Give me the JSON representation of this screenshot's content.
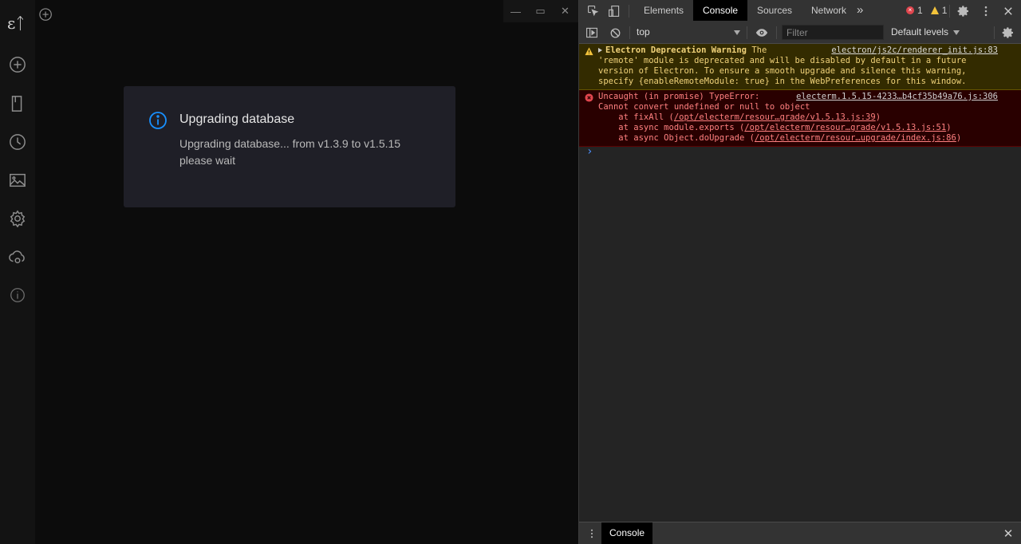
{
  "app": {
    "logo_text": "ɛᛏ",
    "sidebar": [
      {
        "icon": "add-circle-icon"
      },
      {
        "icon": "bookmark-icon"
      },
      {
        "icon": "history-icon"
      },
      {
        "icon": "image-icon"
      },
      {
        "icon": "settings-gear-icon"
      },
      {
        "icon": "cloud-sync-icon"
      },
      {
        "icon": "info-circle-icon"
      }
    ],
    "window_controls": {
      "minimize": "—",
      "maximize": "▭",
      "close": "✕"
    }
  },
  "modal": {
    "title": "Upgrading database",
    "line1": "Upgrading database... from v1.3.9 to v1.5.15",
    "line2": "please wait",
    "accent": "#1890ff"
  },
  "devtools": {
    "tabs": [
      "Elements",
      "Console",
      "Sources",
      "Network"
    ],
    "active_tab": "Console",
    "more_tabs": "»",
    "error_count": "1",
    "warning_count": "1",
    "context": "top",
    "filter_placeholder": "Filter",
    "levels": "Default levels",
    "messages": {
      "warning": {
        "title": "Electron Deprecation Warning",
        "text_lead": " The",
        "source": "electron/js2c/renderer_init.js:83",
        "lines": [
          "'remote' module is deprecated and will be disabled by default in a future",
          "version of Electron. To ensure a smooth upgrade and silence this warning,",
          "specify {enableRemoteModule: true} in the WebPreferences for this window."
        ]
      },
      "error": {
        "head": "Uncaught (in promise) TypeError:",
        "source": "electerm.1.5.15-4233…b4cf35b49a76.js:306",
        "line2": "Cannot convert undefined or null to object",
        "stack": [
          {
            "prefix": "    at fixAll (",
            "link": "/opt/electerm/resour…grade/v1.5.13.js:39",
            "suffix": ")"
          },
          {
            "prefix": "    at async module.exports (",
            "link": "/opt/electerm/resour…grade/v1.5.13.js:51",
            "suffix": ")"
          },
          {
            "prefix": "    at async Object.doUpgrade (",
            "link": "/opt/electerm/resour…upgrade/index.js:86",
            "suffix": ")"
          }
        ]
      }
    },
    "prompt": "›",
    "drawer_tab": "Console",
    "drawer_close": "✕"
  }
}
